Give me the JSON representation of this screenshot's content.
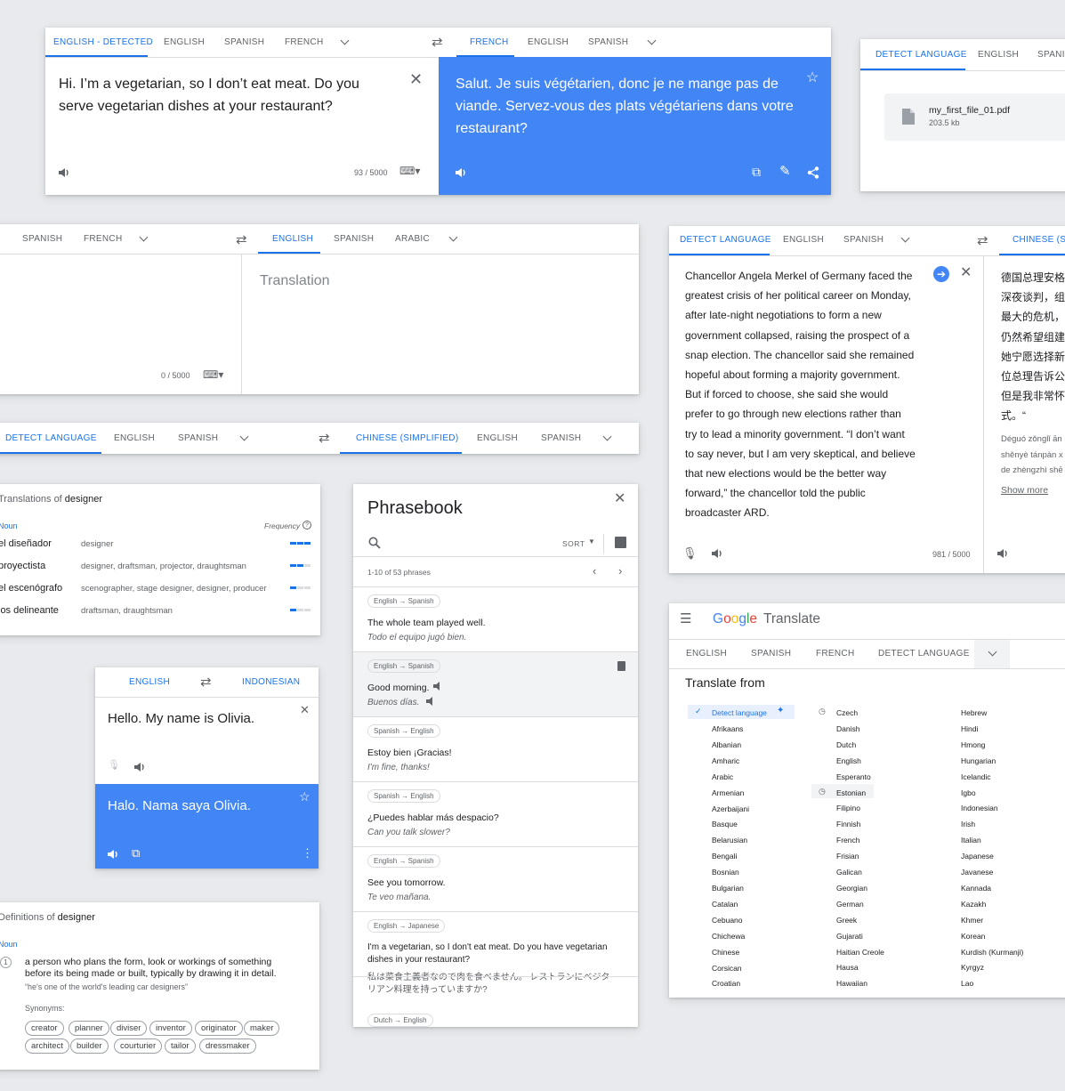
{
  "c1": {
    "tabs_left": [
      "ENGLISH - DETECTED",
      "ENGLISH",
      "SPANISH",
      "FRENCH"
    ],
    "tabs_right": [
      "FRENCH",
      "ENGLISH",
      "SPANISH"
    ],
    "source": "Hi. I’m a vegetarian, so I don’t eat meat. Do you serve vegetarian dishes at your restaurant?",
    "target": "Salut. Je suis végétarien, donc je ne mange pas de viande. Servez-vous des plats végétariens dans votre restaurant?",
    "count": "93 / 5000"
  },
  "c2": {
    "tabs": [
      "DETECT LANGUAGE",
      "ENGLISH",
      "SPANISH"
    ],
    "file_name": "my_first_file_01.pdf",
    "file_size": "203.5 kb"
  },
  "c3": {
    "tabs_left": [
      "SPANISH",
      "FRENCH"
    ],
    "tabs_right": [
      "ENGLISH",
      "SPANISH",
      "ARABIC"
    ],
    "placeholder": "Translation",
    "count": "0 / 5000"
  },
  "c4": {
    "tabs_left": [
      "DETECT LANGUAGE",
      "ENGLISH",
      "SPANISH"
    ],
    "tabs_right": [
      "CHINESE (SIMPLIFIED)",
      "ENGLISH",
      "SPANISH"
    ]
  },
  "c5": {
    "tabs_left": [
      "DETECT LANGUAGE",
      "ENGLISH",
      "SPANISH"
    ],
    "tab_right": "CHINESE (SIM",
    "lines": [
      "Chancellor Angela Merkel of Germany faced the",
      "greatest crisis of her political career on Monday,",
      "after late-night negotiations to form a new",
      "government collapsed, raising the prospect of a",
      "snap election. The chancellor said she remained",
      "hopeful about forming a majority government.",
      "But if forced to choose, she said she would",
      "prefer to go through new elections rather than",
      "try to lead a minority government. “I don’t want",
      "to say never, but I am very skeptical, and believe",
      "that new elections would be the better way",
      "forward,” the chancellor told the public",
      "broadcaster ARD."
    ],
    "zh": [
      "德国总理安格",
      "深夜谈判，组",
      "最大的危机，",
      "仍然希望组建",
      "她宁愿选择新",
      "位总理告诉公",
      "但是我非常怀",
      "式。“"
    ],
    "pinyin": [
      "Déguó zǒnglǐ ān",
      "shěnyè tánpàn x",
      "de zhèngzhì shē"
    ],
    "show_more": "Show more",
    "count": "981 / 5000"
  },
  "c6": {
    "title_a": "Translations of ",
    "title_b": "designer",
    "pos": "Noun",
    "freq": "Frequency",
    "rows": [
      {
        "w": "el diseñador",
        "s": "designer",
        "f": 3
      },
      {
        "w": "proyectista",
        "s": "designer, draftsman, projector, draughtsman",
        "f": 2
      },
      {
        "w": "el escenógrafo",
        "s": "scenographer, stage designer, designer, producer",
        "f": 1
      },
      {
        "w": "los delineante",
        "s": "draftsman, draughtsman",
        "f": 1
      }
    ]
  },
  "c7": {
    "title": "Phrasebook",
    "sort": "SORT",
    "range": "1-10 of 53 phrases",
    "items": [
      {
        "pair": "English → Spanish",
        "src": "The whole team played well.",
        "dst": "Todo el equipo jugó bien."
      },
      {
        "pair": "English → Spanish",
        "src": "Good morning.",
        "dst": "Buenos días."
      },
      {
        "pair": "Spanish → English",
        "src": "Estoy bien ¡Gracias!",
        "dst": "I'm fine, thanks!"
      },
      {
        "pair": "Spanish → English",
        "src": "¿Puedes hablar más despacio?",
        "dst": "Can you talk slower?"
      },
      {
        "pair": "English → Spanish",
        "src": "See you tomorrow.",
        "dst": "Te veo mañana."
      },
      {
        "pair": "English → Japanese",
        "src1": "I'm a vegetarian, so I don't eat meat. Do you have vegetarian",
        "src2": "dishes in your restaurant?",
        "dst1": "私は菜食主義者なので肉を食べません。 レストランにベジタ",
        "dst2": "リアン料理を持っていますか?"
      },
      {
        "pair": "Dutch → English"
      }
    ]
  },
  "c8": {
    "tab_left": "ENGLISH",
    "tab_right": "INDONESIAN",
    "source": "Hello. My name is Olivia.",
    "target": "Halo. Nama saya Olivia."
  },
  "c9": {
    "title_a": "Definitions of ",
    "title_b": "designer",
    "pos": "Noun",
    "num": "1",
    "def1": "a person who plans the form, look or workings of something",
    "def2": "before its being made or built, typically by drawing it in detail.",
    "example": "“he's one of the world's leading car designers”",
    "syn_label": "Synonyms:",
    "synonyms": [
      "creator",
      "planner",
      "diviser",
      "inventor",
      "originator",
      "maker",
      "architect",
      "builder",
      "courturier",
      "tailor",
      "dressmaker"
    ]
  },
  "c10": {
    "logo": "Google",
    "app": "Translate",
    "tabs": [
      "ENGLISH",
      "SPANISH",
      "FRENCH",
      "DETECT LANGUAGE"
    ],
    "heading": "Translate from",
    "detect": "Detect language",
    "col1": [
      "Afrikaans",
      "Albanian",
      "Amharic",
      "Arabic",
      "Armenian",
      "Azerbaijani",
      "Basque",
      "Belarusian",
      "Bengali",
      "Bosnian",
      "Bulgarian",
      "Catalan",
      "Cebuano",
      "Chichewa",
      "Chinese",
      "Corsican",
      "Croatian"
    ],
    "col2": [
      "Czech",
      "Danish",
      "Dutch",
      "English",
      "Esperanto",
      "Estonian",
      "Filipino",
      "Finnish",
      "French",
      "Frisian",
      "Galican",
      "Georgian",
      "German",
      "Greek",
      "Gujarati",
      "Haitian Creole",
      "Hausa",
      "Hawaiian"
    ],
    "col3": [
      "Hebrew",
      "Hindi",
      "Hmong",
      "Hungarian",
      "Icelandic",
      "Igbo",
      "Indonesian",
      "Irish",
      "Italian",
      "Japanese",
      "Javanese",
      "Kannada",
      "Kazakh",
      "Khmer",
      "Korean",
      "Kurdish (Kurmanji)",
      "Kyrgyz",
      "Lao"
    ]
  },
  "colors": {
    "accent": "#1a73e8",
    "blue_panel": "#4285f4"
  }
}
